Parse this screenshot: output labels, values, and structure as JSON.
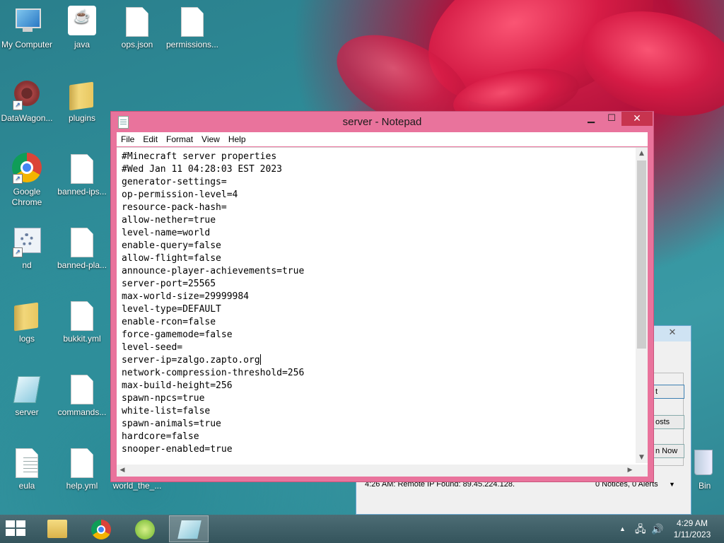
{
  "desktop": {
    "icons": [
      {
        "label": "My Computer",
        "icon": "computer-icon"
      },
      {
        "label": "java",
        "icon": "java-icon"
      },
      {
        "label": "ops.json",
        "icon": "file-icon"
      },
      {
        "label": "permissions...",
        "icon": "file-icon"
      },
      {
        "label": "DataWagon...",
        "icon": "gear-app-icon"
      },
      {
        "label": "plugins",
        "icon": "folder-icon"
      },
      {
        "label": "Google Chrome",
        "icon": "chrome-icon"
      },
      {
        "label": "banned-ips...",
        "icon": "file-icon"
      },
      {
        "label": "nd",
        "icon": "settings-app-icon"
      },
      {
        "label": "banned-pla...",
        "icon": "file-icon"
      },
      {
        "label": "logs",
        "icon": "folder-icon"
      },
      {
        "label": "bukkit.yml",
        "icon": "file-icon"
      },
      {
        "label": "server",
        "icon": "notepad-icon"
      },
      {
        "label": "commands...",
        "icon": "file-icon"
      },
      {
        "label": "eula",
        "icon": "text-file-icon"
      },
      {
        "label": "help.yml",
        "icon": "file-icon"
      },
      {
        "label": "world_the_...",
        "icon": "folder-icon"
      },
      {
        "label": "Bin",
        "icon": "recycle-bin-icon"
      }
    ]
  },
  "background_window": {
    "buttons": [
      "t",
      "osts",
      "n Now"
    ],
    "status_left": "4:26 AM: Remote IP Found: 89.45.224.128.",
    "status_right": "0 Notices, 0 Alerts"
  },
  "notepad": {
    "title": "server - Notepad",
    "controls": {
      "minimize": "▁",
      "maximize": "☐",
      "close": "✕"
    },
    "menu": [
      "File",
      "Edit",
      "Format",
      "View",
      "Help"
    ],
    "lines": [
      "#Minecraft server properties",
      "#Wed Jan 11 04:28:03 EST 2023",
      "generator-settings=",
      "op-permission-level=4",
      "resource-pack-hash=",
      "allow-nether=true",
      "level-name=world",
      "enable-query=false",
      "allow-flight=false",
      "announce-player-achievements=true",
      "server-port=25565",
      "max-world-size=29999984",
      "level-type=DEFAULT",
      "enable-rcon=false",
      "force-gamemode=false",
      "level-seed=",
      "server-ip=zalgo.zapto.org",
      "network-compression-threshold=256",
      "max-build-height=256",
      "spawn-npcs=true",
      "white-list=false",
      "spawn-animals=true",
      "hardcore=false",
      "snooper-enabled=true"
    ],
    "caret_line": 16
  },
  "taskbar": {
    "apps": [
      {
        "name": "file-explorer",
        "icon": "folder-icon"
      },
      {
        "name": "google-chrome",
        "icon": "chrome-icon"
      },
      {
        "name": "utility-app",
        "icon": "green-leaf-icon"
      },
      {
        "name": "notepad",
        "icon": "notepad-icon"
      }
    ],
    "active_app": "notepad",
    "tray_icons": [
      "show-hidden-icons-arrow",
      "network-icon",
      "volume-icon"
    ],
    "time": "4:29 AM",
    "date": "1/11/2023"
  },
  "colors": {
    "notepad_frame": "#e9739c",
    "close_button": "#c7344f",
    "taskbar": "#3f5f67"
  }
}
